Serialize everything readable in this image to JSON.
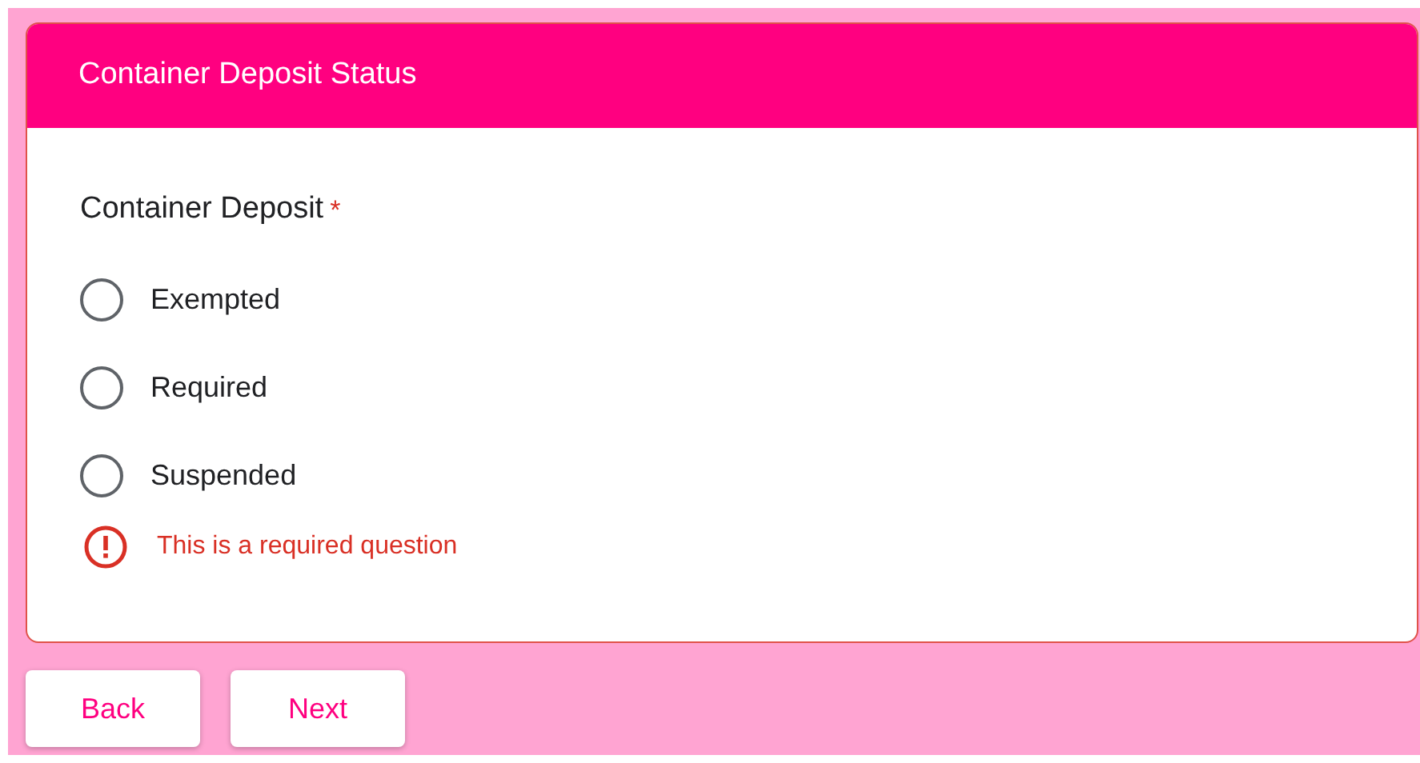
{
  "section": {
    "title": "Container Deposit Status"
  },
  "question": {
    "label": "Container Deposit",
    "required_mark": "*",
    "has_error": true,
    "error": "This is a required question",
    "options": [
      {
        "label": "Exempted",
        "selected": false
      },
      {
        "label": "Required",
        "selected": false
      },
      {
        "label": "Suspended",
        "selected": false
      }
    ]
  },
  "buttons": [
    "Back",
    "Next"
  ]
}
